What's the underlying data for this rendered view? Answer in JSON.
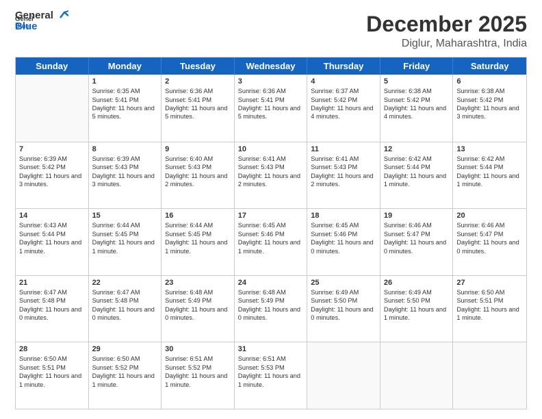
{
  "logo": {
    "line1": "General",
    "line2": "Blue"
  },
  "title": "December 2025",
  "location": "Diglur, Maharashtra, India",
  "header_days": [
    "Sunday",
    "Monday",
    "Tuesday",
    "Wednesday",
    "Thursday",
    "Friday",
    "Saturday"
  ],
  "rows": [
    [
      {
        "num": "",
        "sunrise": "",
        "sunset": "",
        "daylight": ""
      },
      {
        "num": "1",
        "sunrise": "Sunrise: 6:35 AM",
        "sunset": "Sunset: 5:41 PM",
        "daylight": "Daylight: 11 hours and 5 minutes."
      },
      {
        "num": "2",
        "sunrise": "Sunrise: 6:36 AM",
        "sunset": "Sunset: 5:41 PM",
        "daylight": "Daylight: 11 hours and 5 minutes."
      },
      {
        "num": "3",
        "sunrise": "Sunrise: 6:36 AM",
        "sunset": "Sunset: 5:41 PM",
        "daylight": "Daylight: 11 hours and 5 minutes."
      },
      {
        "num": "4",
        "sunrise": "Sunrise: 6:37 AM",
        "sunset": "Sunset: 5:42 PM",
        "daylight": "Daylight: 11 hours and 4 minutes."
      },
      {
        "num": "5",
        "sunrise": "Sunrise: 6:38 AM",
        "sunset": "Sunset: 5:42 PM",
        "daylight": "Daylight: 11 hours and 4 minutes."
      },
      {
        "num": "6",
        "sunrise": "Sunrise: 6:38 AM",
        "sunset": "Sunset: 5:42 PM",
        "daylight": "Daylight: 11 hours and 3 minutes."
      }
    ],
    [
      {
        "num": "7",
        "sunrise": "Sunrise: 6:39 AM",
        "sunset": "Sunset: 5:42 PM",
        "daylight": "Daylight: 11 hours and 3 minutes."
      },
      {
        "num": "8",
        "sunrise": "Sunrise: 6:39 AM",
        "sunset": "Sunset: 5:43 PM",
        "daylight": "Daylight: 11 hours and 3 minutes."
      },
      {
        "num": "9",
        "sunrise": "Sunrise: 6:40 AM",
        "sunset": "Sunset: 5:43 PM",
        "daylight": "Daylight: 11 hours and 2 minutes."
      },
      {
        "num": "10",
        "sunrise": "Sunrise: 6:41 AM",
        "sunset": "Sunset: 5:43 PM",
        "daylight": "Daylight: 11 hours and 2 minutes."
      },
      {
        "num": "11",
        "sunrise": "Sunrise: 6:41 AM",
        "sunset": "Sunset: 5:43 PM",
        "daylight": "Daylight: 11 hours and 2 minutes."
      },
      {
        "num": "12",
        "sunrise": "Sunrise: 6:42 AM",
        "sunset": "Sunset: 5:44 PM",
        "daylight": "Daylight: 11 hours and 1 minute."
      },
      {
        "num": "13",
        "sunrise": "Sunrise: 6:42 AM",
        "sunset": "Sunset: 5:44 PM",
        "daylight": "Daylight: 11 hours and 1 minute."
      }
    ],
    [
      {
        "num": "14",
        "sunrise": "Sunrise: 6:43 AM",
        "sunset": "Sunset: 5:44 PM",
        "daylight": "Daylight: 11 hours and 1 minute."
      },
      {
        "num": "15",
        "sunrise": "Sunrise: 6:44 AM",
        "sunset": "Sunset: 5:45 PM",
        "daylight": "Daylight: 11 hours and 1 minute."
      },
      {
        "num": "16",
        "sunrise": "Sunrise: 6:44 AM",
        "sunset": "Sunset: 5:45 PM",
        "daylight": "Daylight: 11 hours and 1 minute."
      },
      {
        "num": "17",
        "sunrise": "Sunrise: 6:45 AM",
        "sunset": "Sunset: 5:46 PM",
        "daylight": "Daylight: 11 hours and 1 minute."
      },
      {
        "num": "18",
        "sunrise": "Sunrise: 6:45 AM",
        "sunset": "Sunset: 5:46 PM",
        "daylight": "Daylight: 11 hours and 0 minutes."
      },
      {
        "num": "19",
        "sunrise": "Sunrise: 6:46 AM",
        "sunset": "Sunset: 5:47 PM",
        "daylight": "Daylight: 11 hours and 0 minutes."
      },
      {
        "num": "20",
        "sunrise": "Sunrise: 6:46 AM",
        "sunset": "Sunset: 5:47 PM",
        "daylight": "Daylight: 11 hours and 0 minutes."
      }
    ],
    [
      {
        "num": "21",
        "sunrise": "Sunrise: 6:47 AM",
        "sunset": "Sunset: 5:48 PM",
        "daylight": "Daylight: 11 hours and 0 minutes."
      },
      {
        "num": "22",
        "sunrise": "Sunrise: 6:47 AM",
        "sunset": "Sunset: 5:48 PM",
        "daylight": "Daylight: 11 hours and 0 minutes."
      },
      {
        "num": "23",
        "sunrise": "Sunrise: 6:48 AM",
        "sunset": "Sunset: 5:49 PM",
        "daylight": "Daylight: 11 hours and 0 minutes."
      },
      {
        "num": "24",
        "sunrise": "Sunrise: 6:48 AM",
        "sunset": "Sunset: 5:49 PM",
        "daylight": "Daylight: 11 hours and 0 minutes."
      },
      {
        "num": "25",
        "sunrise": "Sunrise: 6:49 AM",
        "sunset": "Sunset: 5:50 PM",
        "daylight": "Daylight: 11 hours and 0 minutes."
      },
      {
        "num": "26",
        "sunrise": "Sunrise: 6:49 AM",
        "sunset": "Sunset: 5:50 PM",
        "daylight": "Daylight: 11 hours and 1 minute."
      },
      {
        "num": "27",
        "sunrise": "Sunrise: 6:50 AM",
        "sunset": "Sunset: 5:51 PM",
        "daylight": "Daylight: 11 hours and 1 minute."
      }
    ],
    [
      {
        "num": "28",
        "sunrise": "Sunrise: 6:50 AM",
        "sunset": "Sunset: 5:51 PM",
        "daylight": "Daylight: 11 hours and 1 minute."
      },
      {
        "num": "29",
        "sunrise": "Sunrise: 6:50 AM",
        "sunset": "Sunset: 5:52 PM",
        "daylight": "Daylight: 11 hours and 1 minute."
      },
      {
        "num": "30",
        "sunrise": "Sunrise: 6:51 AM",
        "sunset": "Sunset: 5:52 PM",
        "daylight": "Daylight: 11 hours and 1 minute."
      },
      {
        "num": "31",
        "sunrise": "Sunrise: 6:51 AM",
        "sunset": "Sunset: 5:53 PM",
        "daylight": "Daylight: 11 hours and 1 minute."
      },
      {
        "num": "",
        "sunrise": "",
        "sunset": "",
        "daylight": ""
      },
      {
        "num": "",
        "sunrise": "",
        "sunset": "",
        "daylight": ""
      },
      {
        "num": "",
        "sunrise": "",
        "sunset": "",
        "daylight": ""
      }
    ]
  ]
}
